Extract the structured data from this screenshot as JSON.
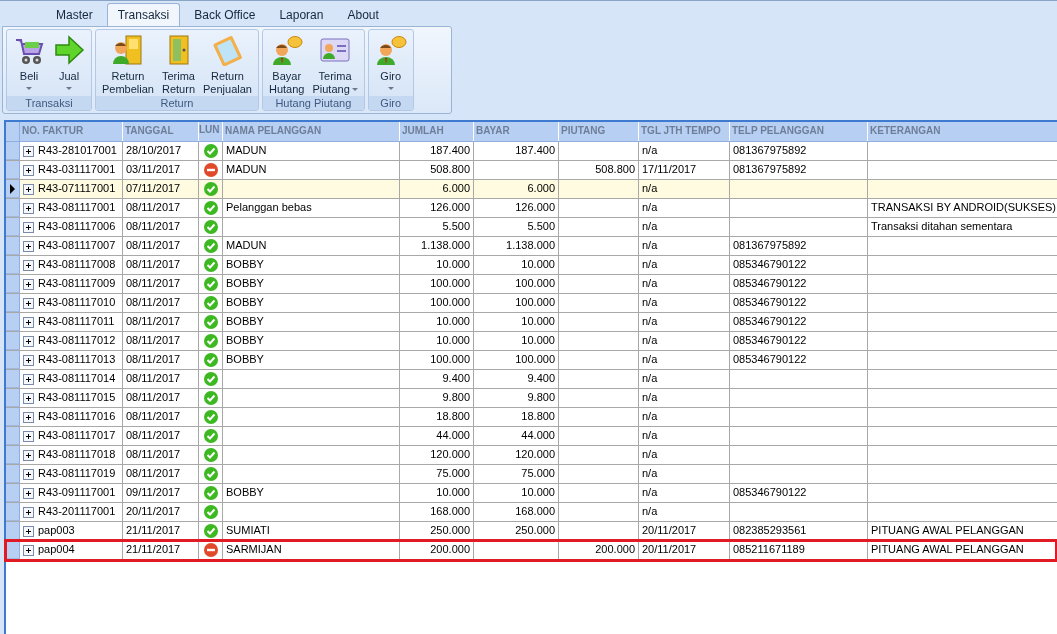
{
  "tabs": [
    {
      "label": "Master",
      "selected": false
    },
    {
      "label": "Transaksi",
      "selected": true
    },
    {
      "label": "Back Office",
      "selected": false
    },
    {
      "label": "Laporan",
      "selected": false
    },
    {
      "label": "About",
      "selected": false
    }
  ],
  "ribbon_groups": [
    {
      "title": "Transaksi",
      "items": [
        {
          "kind": "cart",
          "lines": [
            "Beli"
          ],
          "dropdown": true
        },
        {
          "kind": "arrow",
          "lines": [
            "Jual"
          ],
          "dropdown": true
        }
      ]
    },
    {
      "title": "Return",
      "items": [
        {
          "kind": "person-door",
          "lines": [
            "Return",
            "Pembelian"
          ]
        },
        {
          "kind": "door",
          "lines": [
            "Terima",
            "Return"
          ]
        },
        {
          "kind": "clipboard",
          "lines": [
            "Return",
            "Penjualan"
          ]
        }
      ]
    },
    {
      "title": "Hutang Piutang",
      "items": [
        {
          "kind": "person-chat",
          "lines": [
            "Bayar",
            "Hutang"
          ]
        },
        {
          "kind": "id-card",
          "lines": [
            "Terima",
            "Piutang"
          ],
          "dropdown": true
        }
      ]
    },
    {
      "title": "Giro",
      "items": [
        {
          "kind": "person-chat",
          "lines": [
            "Giro"
          ],
          "dropdown": true
        }
      ]
    }
  ],
  "table": {
    "columns": [
      "NO. FAKTUR",
      "TANGGAL",
      "LUN",
      "NAMA PELANGGAN",
      "JUMLAH",
      "BAYAR",
      "PIUTANG",
      "TGL JTH TEMPO",
      "TELP PELANGGAN",
      "KETERANGAN"
    ],
    "rows": [
      {
        "faktur": "R43-281017001",
        "tanggal": "28/10/2017",
        "lunas": true,
        "nama": "MADUN",
        "jumlah": "187.400",
        "bayar": "187.400",
        "tempo": "n/a",
        "telp": "081367975892",
        "selected": false,
        "highlighted": false
      },
      {
        "faktur": "R43-031117001",
        "tanggal": "03/11/2017",
        "lunas": false,
        "nama": "MADUN",
        "jumlah": "508.800",
        "piutang": "508.800",
        "tempo": "17/11/2017",
        "telp": "081367975892",
        "selected": false,
        "highlighted": false
      },
      {
        "faktur": "R43-071117001",
        "tanggal": "07/11/2017",
        "lunas": true,
        "jumlah": "6.000",
        "bayar": "6.000",
        "tempo": "n/a",
        "selected": true,
        "highlighted": false
      },
      {
        "faktur": "R43-081117001",
        "tanggal": "08/11/2017",
        "lunas": true,
        "nama": "Pelanggan bebas",
        "jumlah": "126.000",
        "bayar": "126.000",
        "tempo": "n/a",
        "ket": "TRANSAKSI BY ANDROID(SUKSES)",
        "selected": false,
        "highlighted": false
      },
      {
        "faktur": "R43-081117006",
        "tanggal": "08/11/2017",
        "lunas": true,
        "jumlah": "5.500",
        "bayar": "5.500",
        "tempo": "n/a",
        "ket": "Transaksi ditahan sementara",
        "selected": false,
        "highlighted": false
      },
      {
        "faktur": "R43-081117007",
        "tanggal": "08/11/2017",
        "lunas": true,
        "nama": "MADUN",
        "jumlah": "1.138.000",
        "bayar": "1.138.000",
        "tempo": "n/a",
        "telp": "081367975892",
        "selected": false,
        "highlighted": false
      },
      {
        "faktur": "R43-081117008",
        "tanggal": "08/11/2017",
        "lunas": true,
        "nama": "BOBBY",
        "jumlah": "10.000",
        "bayar": "10.000",
        "tempo": "n/a",
        "telp": "085346790122",
        "selected": false,
        "highlighted": false
      },
      {
        "faktur": "R43-081117009",
        "tanggal": "08/11/2017",
        "lunas": true,
        "nama": "BOBBY",
        "jumlah": "100.000",
        "bayar": "100.000",
        "tempo": "n/a",
        "telp": "085346790122",
        "selected": false,
        "highlighted": false
      },
      {
        "faktur": "R43-081117010",
        "tanggal": "08/11/2017",
        "lunas": true,
        "nama": "BOBBY",
        "jumlah": "100.000",
        "bayar": "100.000",
        "tempo": "n/a",
        "telp": "085346790122",
        "selected": false,
        "highlighted": false
      },
      {
        "faktur": "R43-081117011",
        "tanggal": "08/11/2017",
        "lunas": true,
        "nama": "BOBBY",
        "jumlah": "10.000",
        "bayar": "10.000",
        "tempo": "n/a",
        "telp": "085346790122",
        "selected": false,
        "highlighted": false
      },
      {
        "faktur": "R43-081117012",
        "tanggal": "08/11/2017",
        "lunas": true,
        "nama": "BOBBY",
        "jumlah": "10.000",
        "bayar": "10.000",
        "tempo": "n/a",
        "telp": "085346790122",
        "selected": false,
        "highlighted": false
      },
      {
        "faktur": "R43-081117013",
        "tanggal": "08/11/2017",
        "lunas": true,
        "nama": "BOBBY",
        "jumlah": "100.000",
        "bayar": "100.000",
        "tempo": "n/a",
        "telp": "085346790122",
        "selected": false,
        "highlighted": false
      },
      {
        "faktur": "R43-081117014",
        "tanggal": "08/11/2017",
        "lunas": true,
        "jumlah": "9.400",
        "bayar": "9.400",
        "tempo": "n/a",
        "selected": false,
        "highlighted": false
      },
      {
        "faktur": "R43-081117015",
        "tanggal": "08/11/2017",
        "lunas": true,
        "jumlah": "9.800",
        "bayar": "9.800",
        "tempo": "n/a",
        "selected": false,
        "highlighted": false
      },
      {
        "faktur": "R43-081117016",
        "tanggal": "08/11/2017",
        "lunas": true,
        "jumlah": "18.800",
        "bayar": "18.800",
        "tempo": "n/a",
        "selected": false,
        "highlighted": false
      },
      {
        "faktur": "R43-081117017",
        "tanggal": "08/11/2017",
        "lunas": true,
        "jumlah": "44.000",
        "bayar": "44.000",
        "tempo": "n/a",
        "selected": false,
        "highlighted": false
      },
      {
        "faktur": "R43-081117018",
        "tanggal": "08/11/2017",
        "lunas": true,
        "jumlah": "120.000",
        "bayar": "120.000",
        "tempo": "n/a",
        "selected": false,
        "highlighted": false
      },
      {
        "faktur": "R43-081117019",
        "tanggal": "08/11/2017",
        "lunas": true,
        "jumlah": "75.000",
        "bayar": "75.000",
        "tempo": "n/a",
        "selected": false,
        "highlighted": false
      },
      {
        "faktur": "R43-091117001",
        "tanggal": "09/11/2017",
        "lunas": true,
        "nama": "BOBBY",
        "jumlah": "10.000",
        "bayar": "10.000",
        "tempo": "n/a",
        "telp": "085346790122",
        "selected": false,
        "highlighted": false
      },
      {
        "faktur": "R43-201117001",
        "tanggal": "20/11/2017",
        "lunas": true,
        "jumlah": "168.000",
        "bayar": "168.000",
        "tempo": "n/a",
        "selected": false,
        "highlighted": false
      },
      {
        "faktur": "pap003",
        "tanggal": "21/11/2017",
        "lunas": true,
        "nama": "SUMIATI",
        "jumlah": "250.000",
        "bayar": "250.000",
        "tempo": "20/11/2017",
        "telp": "082385293561",
        "ket": "PITUANG AWAL PELANGGAN",
        "selected": false,
        "highlighted": false
      },
      {
        "faktur": "pap004",
        "tanggal": "21/11/2017",
        "lunas": false,
        "nama": "SARMIJAN",
        "jumlah": "200.000",
        "piutang": "200.000",
        "tempo": "20/11/2017",
        "telp": "085211671189",
        "ket": "PITUANG AWAL PELANGGAN",
        "selected": false,
        "highlighted": true
      }
    ]
  }
}
